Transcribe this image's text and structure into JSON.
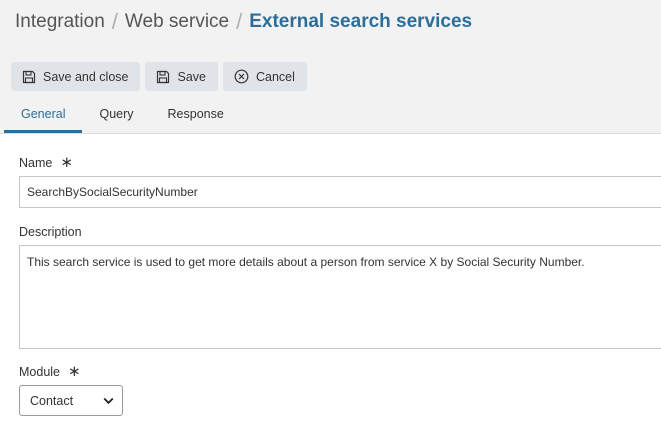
{
  "breadcrumb": {
    "items": [
      "Integration",
      "Web service"
    ],
    "current": "External search services"
  },
  "toolbar": {
    "save_close_label": "Save and close",
    "save_label": "Save",
    "cancel_label": "Cancel"
  },
  "tabs": [
    {
      "label": "General",
      "active": true
    },
    {
      "label": "Query",
      "active": false
    },
    {
      "label": "Response",
      "active": false
    }
  ],
  "form": {
    "name": {
      "label": "Name",
      "required_mark": "∗",
      "value": "SearchBySocialSecurityNumber"
    },
    "description": {
      "label": "Description",
      "value": "This search service is used to get more details about a person from service X by Social Security Number."
    },
    "module": {
      "label": "Module",
      "required_mark": "∗",
      "value": "Contact"
    }
  },
  "colors": {
    "accent": "#2c6e99",
    "header_bg": "#f2f2f2",
    "button_bg": "#e0e4e8"
  },
  "icons": {
    "save_close": "floppy-disk-icon",
    "save": "floppy-disk-icon",
    "cancel": "circle-x-icon",
    "select_arrow": "chevron-down-icon"
  }
}
